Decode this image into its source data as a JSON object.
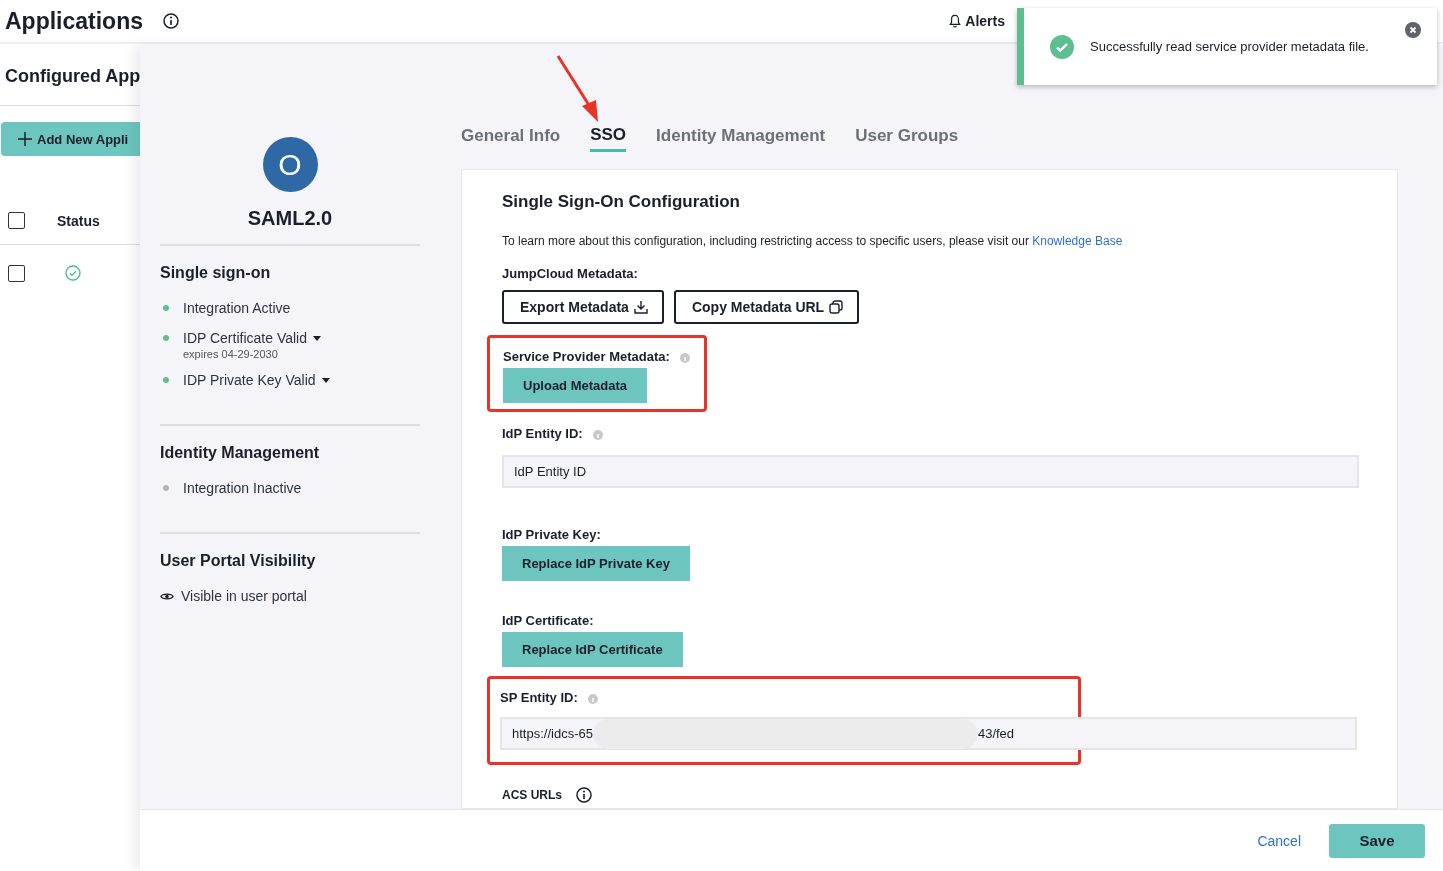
{
  "page": {
    "title": "Applications",
    "alerts": "Alerts"
  },
  "list": {
    "title": "Configured App",
    "add_button": "Add New Appli",
    "header_checked": false,
    "columns": [
      "Status"
    ],
    "rows": [
      {
        "checked": false,
        "ok": true
      }
    ]
  },
  "drawer": {
    "app": {
      "initial": "O",
      "name": "SAML2.0"
    },
    "sections": [
      {
        "title": "Single sign-on",
        "items": [
          {
            "kind": "dot",
            "label": "Integration Active",
            "color": "#5dbf8f",
            "dropdown": false
          },
          {
            "kind": "dot",
            "label": "IDP Certificate Valid",
            "color": "#5dbf8f",
            "dropdown": true,
            "note": "expires 04-29-2030"
          },
          {
            "kind": "dot",
            "label": "IDP Private Key Valid",
            "color": "#5dbf8f",
            "dropdown": true
          }
        ]
      },
      {
        "title": "Identity Management",
        "items": [
          {
            "kind": "dot",
            "label": "Integration Inactive",
            "color": "#b5b5b5",
            "dropdown": false
          }
        ]
      },
      {
        "title": "User Portal Visibility",
        "items": [
          {
            "kind": "eye",
            "label": "Visible in user portal",
            "dropdown": false
          }
        ]
      }
    ],
    "tabs": [
      {
        "label": "General Info",
        "selected": false,
        "pointed": false
      },
      {
        "label": "SSO",
        "selected": true,
        "pointed": true
      },
      {
        "label": "Identity Management",
        "selected": false,
        "pointed": false
      },
      {
        "label": "User Groups",
        "selected": false,
        "pointed": false
      }
    ],
    "config": {
      "title": "Single Sign-On Configuration",
      "intro": "To learn more about this configuration, including restricting access to specific users, please visit our",
      "link": "Knowledge Base",
      "jumpcloud_label": "JumpCloud Metadata:",
      "export_button": "Export Metadata",
      "copy_button": "Copy Metadata URL",
      "sp_metadata": {
        "label": "Service Provider Metadata:",
        "button": "Upload Metadata",
        "highlighted": true
      },
      "idp_entity": {
        "label": "IdP Entity ID:",
        "placeholder": "IdP Entity ID"
      },
      "private_key": {
        "label": "IdP Private Key:",
        "button": "Replace IdP Private Key"
      },
      "certificate": {
        "label": "IdP Certificate:",
        "button": "Replace IdP Certificate"
      },
      "sp_entity": {
        "label": "SP Entity ID:",
        "value_start": "https://idcs-65",
        "value_end": "43/fed",
        "redacted": true,
        "highlighted": true
      },
      "acs_label": "ACS URLs"
    },
    "footer": {
      "cancel": "Cancel",
      "save": "Save"
    }
  },
  "toast": {
    "message": "Successfully read service provider metadata file."
  }
}
